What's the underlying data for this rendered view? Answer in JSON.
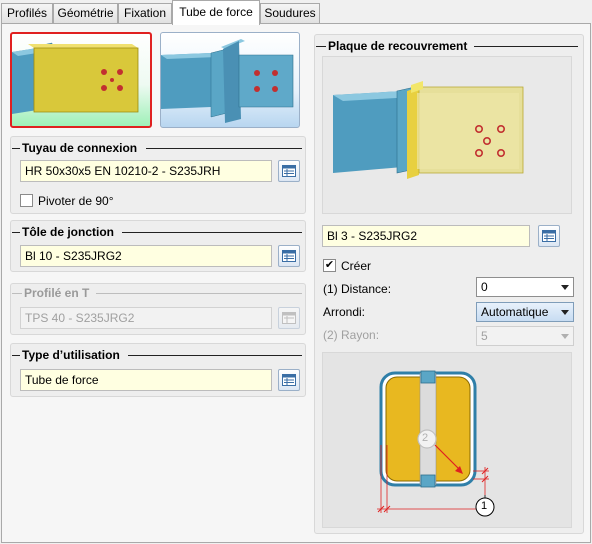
{
  "tabs": [
    {
      "label": "Profilés"
    },
    {
      "label": "Géométrie"
    },
    {
      "label": "Fixation"
    },
    {
      "label": "Tube de force"
    },
    {
      "label": "Soudures"
    }
  ],
  "active_tab": "Tube de force",
  "connection_pipe": {
    "title": "Tuyau de connexion",
    "value": "HR 50x30x5 EN 10210-2 - S235JRH",
    "rotate_label": "Pivoter de 90°",
    "rotate_checked": false
  },
  "junction_plate": {
    "title": "Tôle de jonction",
    "value": "Bl 10 - S235JRG2"
  },
  "t_profile": {
    "title": "Profilé en T",
    "value": "TPS 40 - S235JRG2",
    "disabled": true
  },
  "usage_type": {
    "title": "Type d’utilisation",
    "value": "Tube de force"
  },
  "cover_plate": {
    "title": "Plaque de recouvrement",
    "value": "Bl 3 - S235JRG2",
    "create_label": "Créer",
    "create_checked": true,
    "distance_label": "(1) Distance:",
    "distance_value": "0",
    "rounding_label": "Arrondi:",
    "rounding_value": "Automatique",
    "radius_label": "(2) Rayon:",
    "radius_value": "5"
  },
  "diagram": {
    "marker_1": "1",
    "marker_2": "2"
  },
  "colors": {
    "selected_border": "#e02020",
    "yellow_steel": "#e8b820",
    "blue_profile": "#5aa6c6",
    "field_bg": "#ffffe1",
    "dimension_red": "#e02020"
  }
}
